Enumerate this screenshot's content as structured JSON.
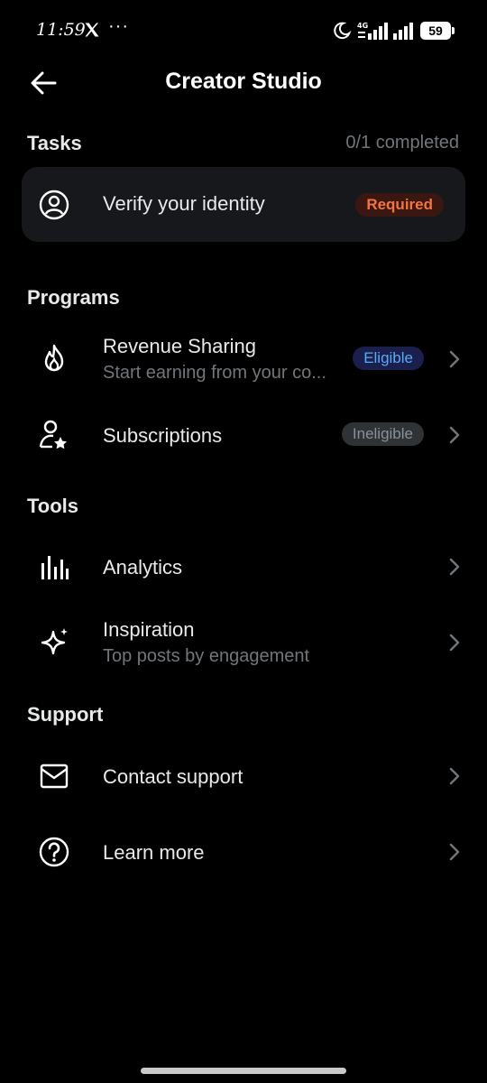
{
  "statusbar": {
    "time": "11:59",
    "dots": "···",
    "network": "4G",
    "battery": "59"
  },
  "header": {
    "title": "Creator Studio",
    "back_icon": "arrow-left-icon"
  },
  "tasks": {
    "title": "Tasks",
    "count": "0/1 completed",
    "items": [
      {
        "label": "Verify your identity",
        "badge": "Required",
        "icon": "user-circle-icon"
      }
    ]
  },
  "programs": {
    "title": "Programs",
    "items": [
      {
        "label": "Revenue Sharing",
        "sub": "Start earning from your co...",
        "badge": "Eligible",
        "icon": "flame-icon"
      },
      {
        "label": "Subscriptions",
        "badge": "Ineligible",
        "icon": "user-star-icon"
      }
    ]
  },
  "tools": {
    "title": "Tools",
    "items": [
      {
        "label": "Analytics",
        "icon": "bar-chart-icon"
      },
      {
        "label": "Inspiration",
        "sub": "Top posts by engagement",
        "icon": "sparkle-icon"
      }
    ]
  },
  "support": {
    "title": "Support",
    "items": [
      {
        "label": "Contact support",
        "icon": "envelope-icon"
      },
      {
        "label": "Learn more",
        "icon": "question-circle-icon"
      }
    ]
  },
  "colors": {
    "background": "#000000",
    "card": "#16181c",
    "required": "#f4743f",
    "eligible": "#5aa9f5",
    "muted": "#71767b"
  }
}
